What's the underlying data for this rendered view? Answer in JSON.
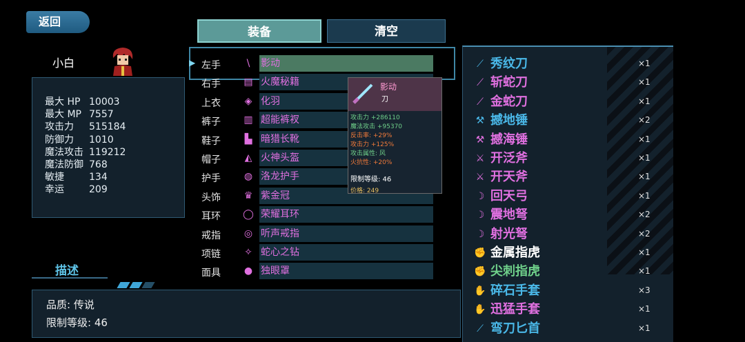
{
  "back_label": "返回",
  "character": {
    "name": "小白"
  },
  "stats": [
    {
      "label": "最大 HP",
      "value": "10003"
    },
    {
      "label": "最大 MP",
      "value": "7557"
    },
    {
      "label": "攻击力",
      "value": "515184"
    },
    {
      "label": "防御力",
      "value": "1010"
    },
    {
      "label": "魔法攻击",
      "value": "119212"
    },
    {
      "label": "魔法防御",
      "value": "768"
    },
    {
      "label": "敏捷",
      "value": "134"
    },
    {
      "label": "幸运",
      "value": "209"
    }
  ],
  "tabs": {
    "equip": "装备",
    "clear": "清空"
  },
  "equipment": [
    {
      "slot": "左手",
      "item": "影动",
      "color": "#e070e0",
      "icon": "blade-icon",
      "glyph": "\\",
      "selected": true
    },
    {
      "slot": "右手",
      "item": "火魔秘籍",
      "color": "#e070e0",
      "icon": "book-icon",
      "glyph": "▤"
    },
    {
      "slot": "上衣",
      "item": "化羽",
      "color": "#e070e0",
      "icon": "armor-icon",
      "glyph": "◈"
    },
    {
      "slot": "裤子",
      "item": "超能裤衩",
      "color": "#e070e0",
      "icon": "pants-icon",
      "glyph": "▥"
    },
    {
      "slot": "鞋子",
      "item": "暗猎长靴",
      "color": "#e070e0",
      "icon": "boots-icon",
      "glyph": "▙"
    },
    {
      "slot": "帽子",
      "item": "火神头盔",
      "color": "#e070e0",
      "icon": "helmet-icon",
      "glyph": "◭"
    },
    {
      "slot": "护手",
      "item": "洛龙护手",
      "color": "#e070e0",
      "icon": "gauntlet-icon",
      "glyph": "◍"
    },
    {
      "slot": "头饰",
      "item": "紫金冠",
      "color": "#e070e0",
      "icon": "crown-icon",
      "glyph": "♛"
    },
    {
      "slot": "耳环",
      "item": "荣耀耳环",
      "color": "#e070e0",
      "icon": "earring-icon",
      "glyph": "◯"
    },
    {
      "slot": "戒指",
      "item": "听声戒指",
      "color": "#e070e0",
      "icon": "ring-icon",
      "glyph": "◎"
    },
    {
      "slot": "项链",
      "item": "蛇心之钻",
      "color": "#e070e0",
      "icon": "necklace-icon",
      "glyph": "✧"
    },
    {
      "slot": "面具",
      "item": "独眼罩",
      "color": "#e070e0",
      "icon": "eyepatch-icon",
      "glyph": "●"
    }
  ],
  "tooltip": {
    "name": "影动",
    "type": "刀",
    "lines": [
      {
        "text": "攻击力 +286110",
        "color": "#6fd08a"
      },
      {
        "text": "魔法攻击 +95370",
        "color": "#6fd08a"
      },
      {
        "text": "反击率: +29%",
        "color": "#f07a3a"
      },
      {
        "text": "攻击力 +125%",
        "color": "#f07a3a"
      },
      {
        "text": "攻击属性: 风",
        "color": "#6fd08a"
      },
      {
        "text": "火抗性: +20%",
        "color": "#f07a3a"
      }
    ],
    "limit": "限制等级: 46",
    "price": "价格: 249"
  },
  "inventory": [
    {
      "name": "秀纹刀",
      "count": "×1",
      "color": "#4ab8e8",
      "icon": "sword-icon",
      "glyph": "⟋"
    },
    {
      "name": "斩蛇刀",
      "count": "×1",
      "color": "#e070e0",
      "icon": "sword-icon",
      "glyph": "⟋"
    },
    {
      "name": "金蛇刀",
      "count": "×1",
      "color": "#e070e0",
      "icon": "sword-icon",
      "glyph": "⟋"
    },
    {
      "name": "撼地锤",
      "count": "×2",
      "color": "#4ab8e8",
      "icon": "hammer-icon",
      "glyph": "⚒"
    },
    {
      "name": "撼海锤",
      "count": "×1",
      "color": "#e070e0",
      "icon": "hammer-icon",
      "glyph": "⚒"
    },
    {
      "name": "开泛斧",
      "count": "×1",
      "color": "#e070e0",
      "icon": "axe-icon",
      "glyph": "⚔"
    },
    {
      "name": "开天斧",
      "count": "×1",
      "color": "#e070e0",
      "icon": "axe-icon",
      "glyph": "⚔"
    },
    {
      "name": "回天弓",
      "count": "×1",
      "color": "#e070e0",
      "icon": "bow-icon",
      "glyph": "☽"
    },
    {
      "name": "震地弩",
      "count": "×2",
      "color": "#e070e0",
      "icon": "crossbow-icon",
      "glyph": "☽"
    },
    {
      "name": "射光弩",
      "count": "×2",
      "color": "#e070e0",
      "icon": "crossbow-icon",
      "glyph": "☽"
    },
    {
      "name": "金属指虎",
      "count": "×1",
      "color": "#ffffff",
      "icon": "knuckle-icon",
      "glyph": "✊"
    },
    {
      "name": "尖刺指虎",
      "count": "×1",
      "color": "#6fd08a",
      "icon": "knuckle-icon",
      "glyph": "✊"
    },
    {
      "name": "碎石手套",
      "count": "×3",
      "color": "#4ab8e8",
      "icon": "glove-icon",
      "glyph": "✋"
    },
    {
      "name": "迅猛手套",
      "count": "×1",
      "color": "#e070e0",
      "icon": "glove-icon",
      "glyph": "✋"
    },
    {
      "name": "弯刀匕首",
      "count": "×1",
      "color": "#4ab8e8",
      "icon": "dagger-icon",
      "glyph": "⟋"
    }
  ],
  "description": {
    "title": "描述",
    "quality": "品质: 传说",
    "limit": "限制等级: 46"
  }
}
